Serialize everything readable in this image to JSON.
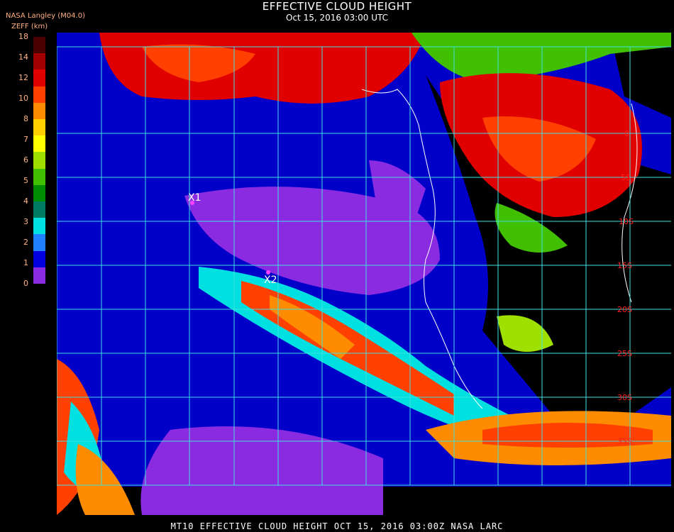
{
  "title": "EFFECTIVE CLOUD HEIGHT",
  "subtitle": "Oct 15, 2016 03:00 UTC",
  "organization": "NASA Langley (M04.0)",
  "colorbar": {
    "unit_label": "ZEFF (km)",
    "tick_labels": [
      "18",
      "14",
      "12",
      "10",
      "8",
      "7",
      "6",
      "5",
      "4",
      "3",
      "2",
      "1",
      "0"
    ],
    "colors": [
      "#4a0000",
      "#a00000",
      "#e00000",
      "#ff4000",
      "#ff8c00",
      "#ffd000",
      "#ffff00",
      "#a0e000",
      "#40c000",
      "#008c00",
      "#007a60",
      "#00e0e0",
      "#2080ff",
      "#0000e0",
      "#8a2be2"
    ]
  },
  "map": {
    "latitude_labels": [
      "0",
      "5S",
      "10S",
      "15S",
      "20S",
      "25S",
      "30S",
      "35S"
    ],
    "markers": [
      {
        "label": "X1",
        "color": "#ff40ff"
      },
      {
        "label": "X2",
        "color": "#ff40ff"
      }
    ],
    "grid_color": "#40e0e0",
    "coast_color": "#ffffff",
    "lat_label_color": "#ff2020"
  },
  "footer": "MT10  EFFECTIVE CLOUD HEIGHT  OCT 15, 2016 03:00Z  NASA LARC"
}
